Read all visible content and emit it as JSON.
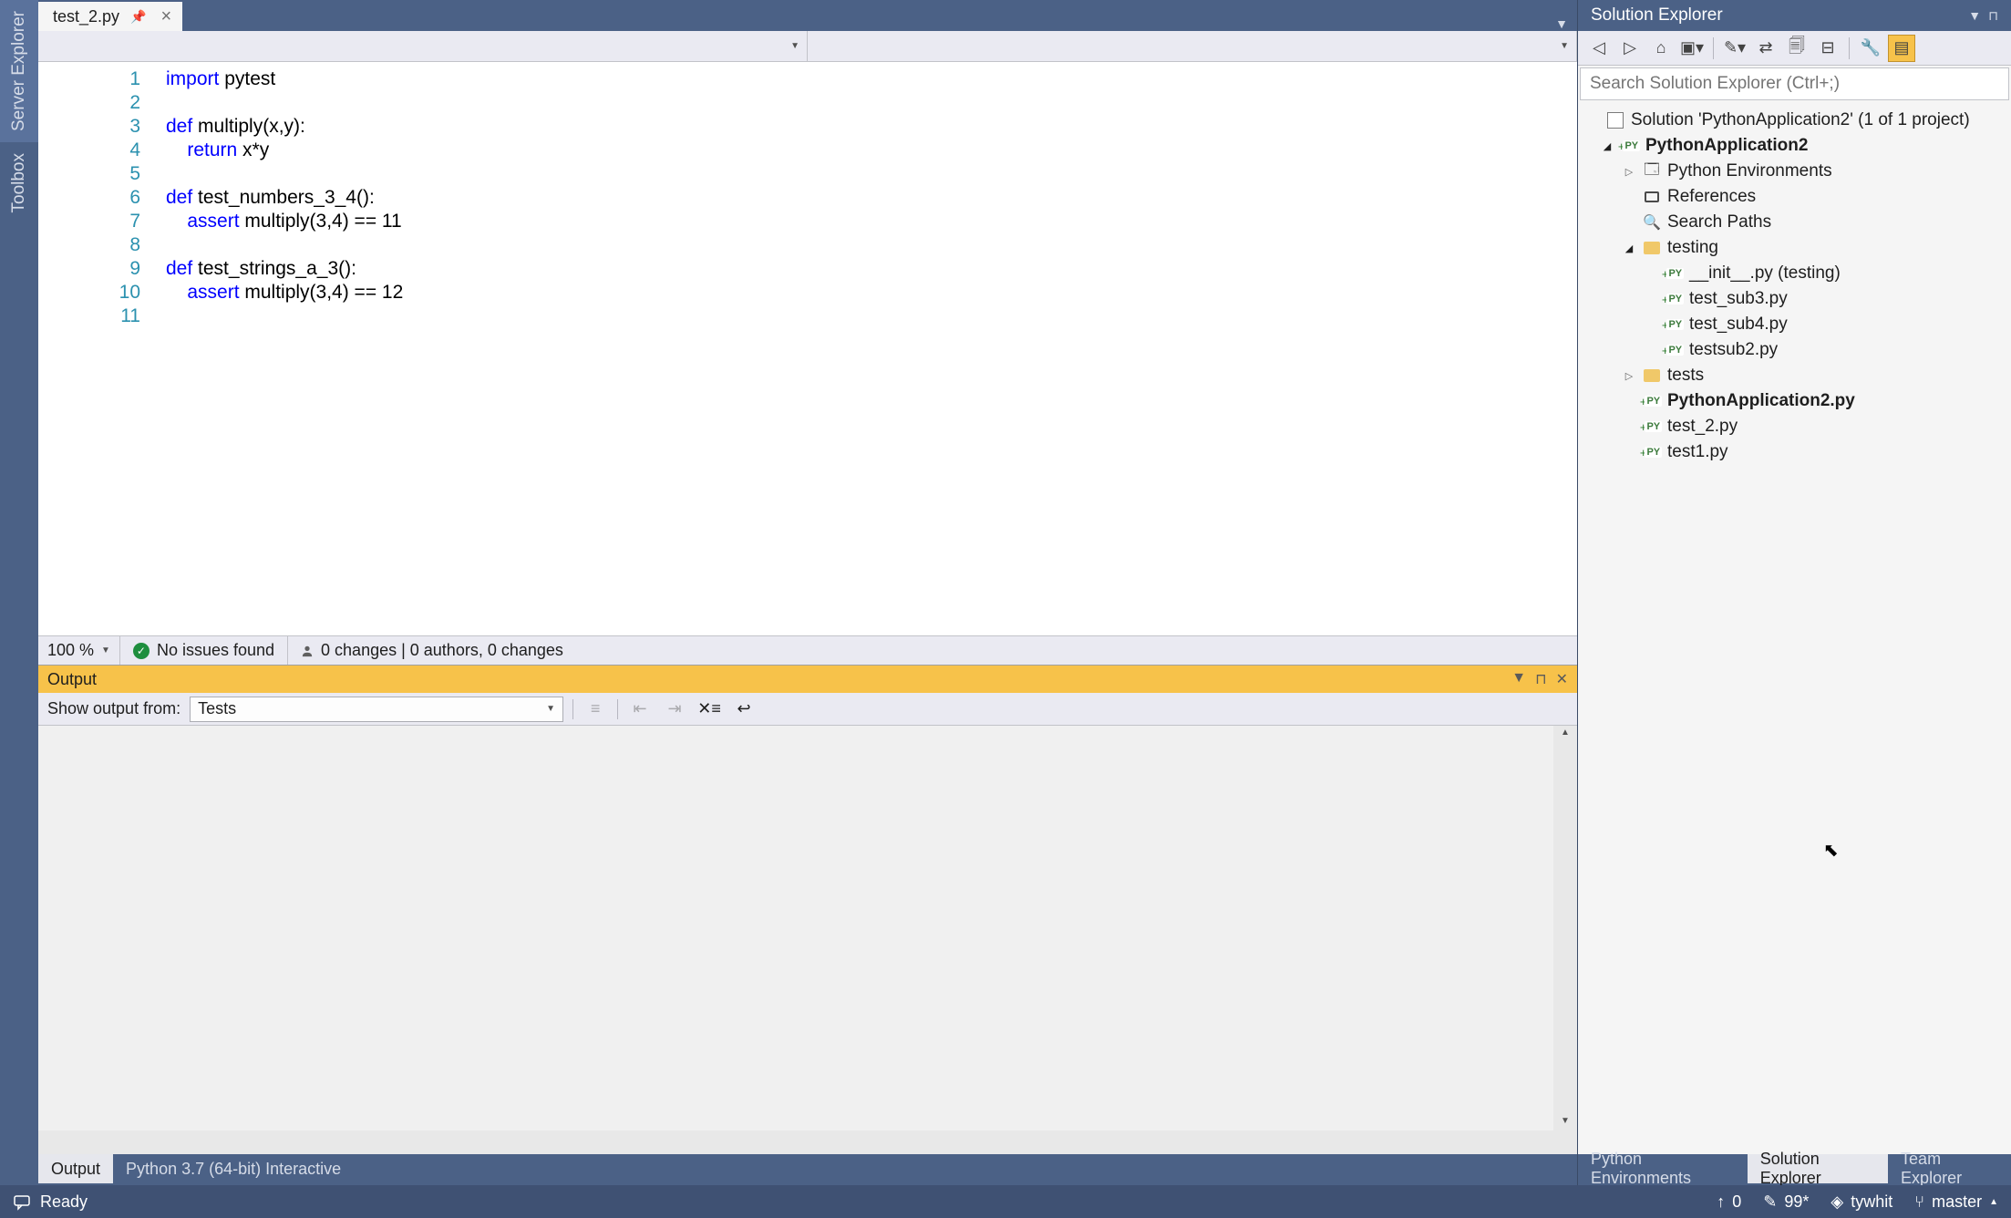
{
  "left_panels": {
    "server_explorer": "Server Explorer",
    "toolbox": "Toolbox"
  },
  "tabs": {
    "active_tab": "test_2.py"
  },
  "editor": {
    "lines": [
      "1",
      "2",
      "3",
      "4",
      "5",
      "6",
      "7",
      "8",
      "9",
      "10",
      "11"
    ],
    "code_tokens": [
      [
        {
          "t": "import",
          "c": "kw"
        },
        {
          "t": " pytest",
          "c": ""
        }
      ],
      [],
      [
        {
          "t": "def",
          "c": "kw"
        },
        {
          "t": " multiply(x,y):",
          "c": ""
        }
      ],
      [
        {
          "t": "    ",
          "c": ""
        },
        {
          "t": "return",
          "c": "kw"
        },
        {
          "t": " x*y",
          "c": ""
        }
      ],
      [],
      [
        {
          "t": "def",
          "c": "kw"
        },
        {
          "t": " test_numbers_3_4():",
          "c": ""
        }
      ],
      [
        {
          "t": "    ",
          "c": ""
        },
        {
          "t": "assert",
          "c": "kw"
        },
        {
          "t": " multiply(3,4) == 11",
          "c": ""
        }
      ],
      [],
      [
        {
          "t": "def",
          "c": "kw"
        },
        {
          "t": " test_strings_a_3():",
          "c": ""
        }
      ],
      [
        {
          "t": "    ",
          "c": ""
        },
        {
          "t": "assert",
          "c": "kw"
        },
        {
          "t": " multiply(3,4) == 12",
          "c": ""
        }
      ],
      []
    ]
  },
  "code_status": {
    "zoom": "100 %",
    "issues": "No issues found",
    "changes": "0 changes | 0 authors, 0 changes"
  },
  "output": {
    "title": "Output",
    "show_from_label": "Show output from:",
    "show_from_value": "Tests"
  },
  "bottom_tabs_left": {
    "output": "Output",
    "python_interactive": "Python 3.7 (64-bit) Interactive"
  },
  "solution_explorer": {
    "title": "Solution Explorer",
    "search_placeholder": "Search Solution Explorer (Ctrl+;)",
    "tree": {
      "solution": "Solution 'PythonApplication2' (1 of 1 project)",
      "project": "PythonApplication2",
      "env": "Python Environments",
      "refs": "References",
      "search_paths": "Search Paths",
      "testing_folder": "testing",
      "init_py": "__init__.py (testing)",
      "test_sub3": "test_sub3.py",
      "test_sub4": "test_sub4.py",
      "testsub2": "testsub2.py",
      "tests_folder": "tests",
      "main_py": "PythonApplication2.py",
      "test_2": "test_2.py",
      "test1": "test1.py"
    }
  },
  "bottom_tabs_right": {
    "python_env": "Python Environments",
    "solution_explorer": "Solution Explorer",
    "team_explorer": "Team Explorer"
  },
  "status_bar": {
    "ready": "Ready",
    "publish_count": "0",
    "pending_edits": "99*",
    "user": "tywhit",
    "branch": "master"
  }
}
